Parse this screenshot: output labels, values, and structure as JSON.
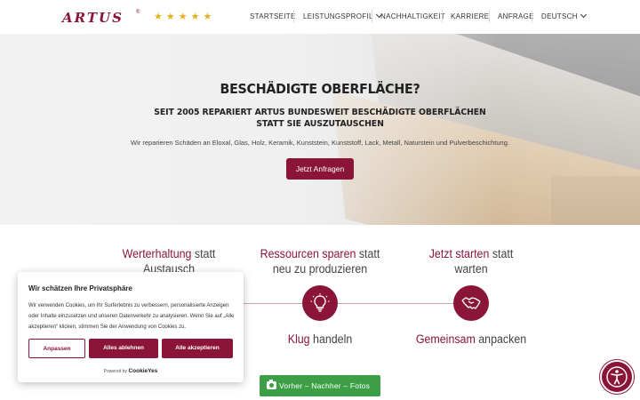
{
  "header": {
    "logo": "ARTUS",
    "logo_reg": "®",
    "rating_stars": "★★★★★",
    "nav": [
      {
        "label": "STARTSEITE"
      },
      {
        "label": "LEISTUNGSPROFIL"
      },
      {
        "label": "NACHHALTIGKEIT"
      },
      {
        "label": "KARRIERE"
      },
      {
        "label": "ANFRAGE"
      }
    ],
    "language": "DEUTSCH"
  },
  "hero": {
    "title": "BESCHÄDIGTE OBERFLÄCHE?",
    "subtitle_line1": "SEIT 2005 REPARIERT ARTUS BUNDESWEIT BESCHÄDIGTE OBERFLÄCHEN",
    "subtitle_line2": "STATT SIE AUSZUTAUSCHEN",
    "description": "Wir reparieren Schäden an Eloxal, Glas, Holz, Keramik, Kunststein, Kunststoff, Lack, Metall, Naturstein und Pulverbeschichtung.",
    "cta_label": "Jetzt Anfragen"
  },
  "features": {
    "top": [
      {
        "accent": "Werterhaltung",
        "rest_1": " statt",
        "line2": "Austausch"
      },
      {
        "accent": "Ressourcen sparen",
        "rest_1": " statt",
        "line2": "neu zu produzieren"
      },
      {
        "accent": "Jetzt starten",
        "rest_1": " statt",
        "line2": "warten"
      }
    ],
    "bottom": [
      {
        "accent": "Klug",
        "rest": " handeln"
      },
      {
        "accent": "Gemeinsam",
        "rest": " anpacken"
      }
    ]
  },
  "cookie_banner": {
    "title": "Wir schätzen Ihre Privatsphäre",
    "text": "Wir verwenden Cookies, um Ihr Surferlebnis zu verbessern, personalisierte Anzeigen oder Inhalte einzusetzen und unseren Datenverkehr zu analysieren. Wenn Sie auf „Alle akzeptieren“ klicken, stimmen Sie der Anwendung von Cookies zu.",
    "customize_label": "Anpassen",
    "reject_label": "Alles ablehnen",
    "accept_label": "Alle akzeptieren",
    "powered_by": "Powered by",
    "brand": "CookieYes"
  },
  "gallery_button": {
    "label": "Vorher – Nachher – Fotos"
  },
  "colors": {
    "brand": "#8b1538",
    "gallery": "#3c9e45",
    "stars": "#e3b21c"
  },
  "icons": [
    "star-icon",
    "chevron-down-icon",
    "lightbulb-icon",
    "handshake-icon",
    "camera-icon",
    "accessibility-icon"
  ]
}
